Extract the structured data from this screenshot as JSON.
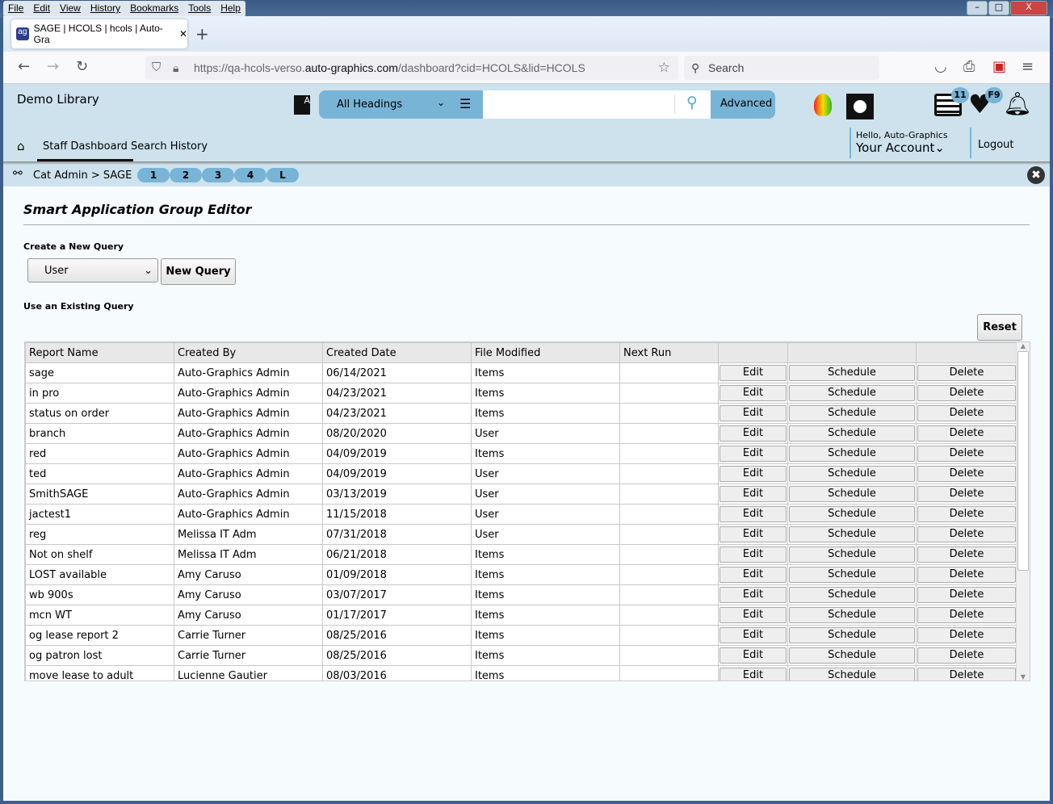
{
  "browser": {
    "menu": [
      "File",
      "Edit",
      "View",
      "History",
      "Bookmarks",
      "Tools",
      "Help"
    ],
    "tab_title": "SAGE | HCOLS | hcols | Auto-Gra",
    "url_prefix": "https://qa-hcols-verso.",
    "url_domain": "auto-graphics.com",
    "url_suffix": "/dashboard?cid=HCOLS&lid=HCOLS",
    "search_placeholder": "Search"
  },
  "header": {
    "library": "Demo Library",
    "search_scope": "All Headings",
    "advanced": "Advanced",
    "badge_list": "11",
    "badge_fav": "F9",
    "nav": [
      "Staff Dashboard",
      "Search History"
    ],
    "hello": "Hello, Auto-Graphics",
    "account": "Your Account",
    "logout": "Logout"
  },
  "breadcrumb": {
    "text": "Cat Admin > SAGE",
    "pills": [
      "1",
      "2",
      "3",
      "4",
      "L"
    ]
  },
  "main": {
    "title": "Smart Application Group Editor",
    "create_label": "Create a New Query",
    "type_select": "User",
    "new_query": "New Query",
    "existing_label": "Use an Existing Query",
    "reset": "Reset",
    "columns": [
      "Report Name",
      "Created By",
      "Created Date",
      "File Modified",
      "Next Run",
      "",
      "",
      ""
    ],
    "actions": {
      "edit": "Edit",
      "schedule": "Schedule",
      "delete": "Delete"
    },
    "rows": [
      [
        "sage",
        "Auto-Graphics Admin",
        "06/14/2021",
        "Items",
        ""
      ],
      [
        "in pro",
        "Auto-Graphics Admin",
        "04/23/2021",
        "Items",
        ""
      ],
      [
        "status on order",
        "Auto-Graphics Admin",
        "04/23/2021",
        "Items",
        ""
      ],
      [
        "branch",
        "Auto-Graphics Admin",
        "08/20/2020",
        "User",
        ""
      ],
      [
        "red",
        "Auto-Graphics Admin",
        "04/09/2019",
        "Items",
        ""
      ],
      [
        "ted",
        "Auto-Graphics Admin",
        "04/09/2019",
        "User",
        ""
      ],
      [
        "SmithSAGE",
        "Auto-Graphics Admin",
        "03/13/2019",
        "User",
        ""
      ],
      [
        "jactest1",
        "Auto-Graphics Admin",
        "11/15/2018",
        "User",
        ""
      ],
      [
        "reg",
        "Melissa IT Adm",
        "07/31/2018",
        "User",
        ""
      ],
      [
        "Not on shelf",
        "Melissa IT Adm",
        "06/21/2018",
        "Items",
        ""
      ],
      [
        "LOST available",
        "Amy Caruso",
        "01/09/2018",
        "Items",
        ""
      ],
      [
        "wb 900s",
        "Amy Caruso",
        "03/07/2017",
        "Items",
        ""
      ],
      [
        "mcn WT",
        "Amy Caruso",
        "01/17/2017",
        "Items",
        ""
      ],
      [
        "og lease report 2",
        "Carrie Turner",
        "08/25/2016",
        "Items",
        ""
      ],
      [
        "og patron lost",
        "Carrie Turner",
        "08/25/2016",
        "Items",
        ""
      ],
      [
        "move lease to adult",
        "Lucienne Gautier",
        "08/03/2016",
        "Items",
        ""
      ]
    ]
  }
}
